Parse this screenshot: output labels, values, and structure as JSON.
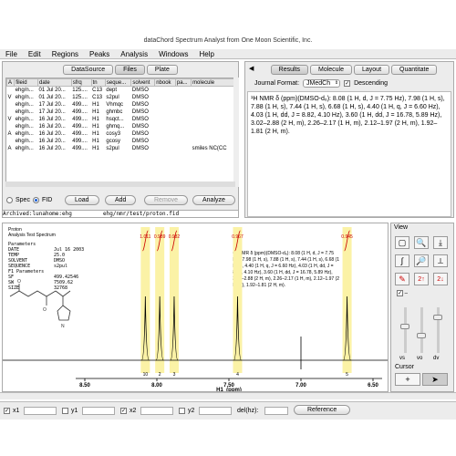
{
  "window": {
    "title": "dataChord Spectrum Analyst  from  One Moon Scientific, Inc."
  },
  "menu": [
    "File",
    "Edit",
    "Regions",
    "Peaks",
    "Analysis",
    "Windows",
    "Help"
  ],
  "left_tabs": [
    "DataSource",
    "Files",
    "Plate"
  ],
  "file_table": {
    "headers": [
      "A",
      "fileid",
      "date",
      "sfrq",
      "tn",
      "seque...",
      "solvent",
      "nbook",
      "pa...",
      "molecule"
    ],
    "rows": [
      [
        "",
        "ehg/n...",
        "01 Jul 20...",
        "125....",
        "C13",
        "dept",
        "DMSO",
        "",
        "",
        ""
      ],
      [
        "V",
        "ehg/n...",
        "01 Jul 20...",
        "125....",
        "C13",
        "s2pul",
        "DMSO",
        "",
        "",
        ""
      ],
      [
        "",
        "ehg/n...",
        "17 Jul 20...",
        "499....",
        "H1",
        "Vhmqc",
        "DMSO",
        "",
        "",
        ""
      ],
      [
        "",
        "ehg/n...",
        "17 Jul 20...",
        "499....",
        "H1",
        "ghmbc",
        "DMSO",
        "",
        "",
        ""
      ],
      [
        "V",
        "ehg/n...",
        "16 Jul 20...",
        "499....",
        "H1",
        "hsqct...",
        "DMSO",
        "",
        "",
        ""
      ],
      [
        "",
        "ehg/n...",
        "16 Jul 20...",
        "499....",
        "H1",
        "ghmq...",
        "DMSO",
        "",
        "",
        ""
      ],
      [
        "A",
        "ehg/n...",
        "16 Jul 20...",
        "499....",
        "H1",
        "cosy3",
        "DMSO",
        "",
        "",
        ""
      ],
      [
        "",
        "ehg/n...",
        "16 Jul 20...",
        "499....",
        "H1",
        "gcosy",
        "DMSO",
        "",
        "",
        ""
      ],
      [
        "A",
        "ehg/n...",
        "16 Jul 20...",
        "499....",
        "H1",
        "s2pul",
        "DMSO",
        "",
        "",
        "smiles NC(CC"
      ]
    ]
  },
  "left_buttons": {
    "spec": "Spec",
    "fid": "FID",
    "load": "Load",
    "add": "Add",
    "remove": "Remove",
    "analyze": "Analyze"
  },
  "archive": {
    "left": "Archived:lunahome:ehg",
    "right": "ehg/nmr/test/proton.fid"
  },
  "right_tabs": [
    "Results",
    "Molecule",
    "Layout",
    "Quantitate"
  ],
  "journal": {
    "label": "Journal Format:",
    "value": "JMedCh",
    "descending": "Descending"
  },
  "results_text": "¹H NMR δ (ppm)(DMSO-d₆): 8.08 (1 H, d, J = 7.75 Hz), 7.98 (1 H, s), 7.88 (1 H, s), 7.44 (1 H, s), 6.68 (1 H, s), 4.40 (1 H, q, J = 6.60 Hz), 4.03 (1 H, dd, J = 8.82, 4.10 Hz), 3.60 (1 H, dd, J = 16.78, 5.89 Hz), 3.02–2.88 (2 H, m), 2.26–2.17 (1 H, m), 2.12–1.97 (2 H, m), 1.92–1.81 (2 H, m).",
  "spectrum": {
    "header": [
      "Proton",
      "Analysis Test Spectrum"
    ],
    "params_title": "Parameters",
    "params": [
      [
        "DATE",
        "Jul 16 2003"
      ],
      [
        "TEMP",
        "25.0"
      ],
      [
        "SOLVENT",
        "DMSO"
      ],
      [
        "SEQUENCE",
        "s2pul"
      ],
      [
        "F1 Parameters",
        ""
      ],
      [
        "SF",
        "499.42546"
      ],
      [
        "SW",
        "7509.62"
      ],
      [
        "SIZE",
        "32768"
      ]
    ],
    "overlay": "¹H NMR δ (ppm)(DMSO-d₆): 8.08 (1 H, d, J = 7.75 Hz), 7.98 (1 H, s), 7.88 (1 H, s), 7.44 (1 H, s), 6.68 (1 H, s), 4.40 (1 H, q, J = 6.60 Hz), 4.03 (1 H, dd, J = 8.82, 4.10 Hz), 3.60 (1 H, dd, J = 16.78, 5.89 Hz), 3.02–2.88 (2 H, m), 2.26–2.17 (1 H, m), 2.12–1.97 (2 H, m), 1.92–1.81 (2 H, m).",
    "xlabel": "H1_(ppm)",
    "ticks": [
      "8.50",
      "8.00",
      "7.50",
      "7.00",
      "6.50"
    ],
    "peaks": [
      {
        "ppm": 8.08,
        "integral": "1.011",
        "num": "10"
      },
      {
        "ppm": 7.98,
        "integral": "0.989",
        "num": "2"
      },
      {
        "ppm": 7.88,
        "integral": "0.982",
        "num": "3"
      },
      {
        "ppm": 7.44,
        "integral": "0.967",
        "num": "4"
      },
      {
        "ppm": 6.68,
        "integral": "0.945",
        "num": "5"
      }
    ]
  },
  "view": {
    "title": "View",
    "labels": [
      "vs",
      "vo",
      "dv"
    ],
    "cursor": "Cursor"
  },
  "bottom": {
    "x1": "x1",
    "y1": "y1",
    "x2": "x2",
    "y2": "y2",
    "del": "del(hz):",
    "reference": "Reference"
  }
}
